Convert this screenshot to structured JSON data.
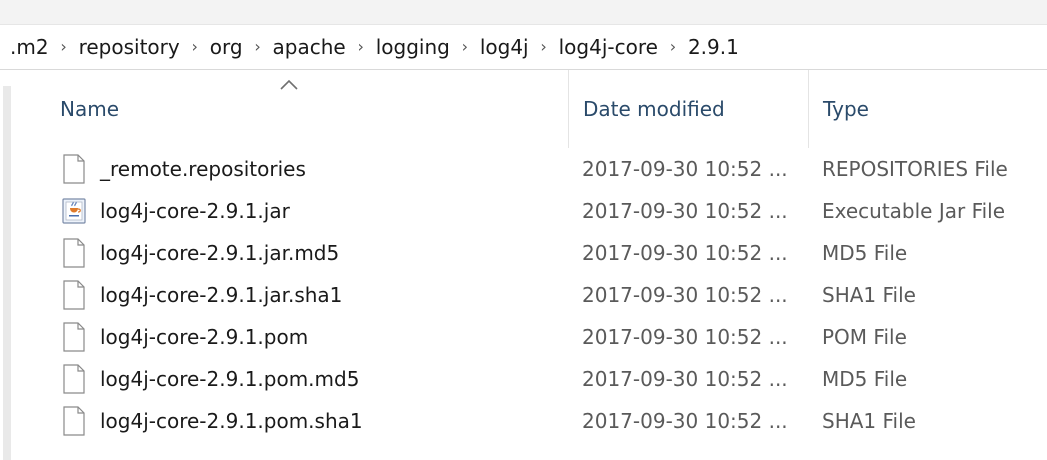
{
  "breadcrumb": {
    "items": [
      ".m2",
      "repository",
      "org",
      "apache",
      "logging",
      "log4j",
      "log4j-core",
      "2.9.1"
    ],
    "separator": "›"
  },
  "columns": {
    "name": "Name",
    "date_modified": "Date modified",
    "type": "Type",
    "sort_indicator": "^"
  },
  "files": [
    {
      "name": "_remote.repositories",
      "date": "2017-09-30 10:52 ...",
      "type": "REPOSITORIES File",
      "icon": "generic-file-icon"
    },
    {
      "name": "log4j-core-2.9.1.jar",
      "date": "2017-09-30 10:52 ...",
      "type": "Executable Jar File",
      "icon": "java-jar-icon"
    },
    {
      "name": "log4j-core-2.9.1.jar.md5",
      "date": "2017-09-30 10:52 ...",
      "type": "MD5 File",
      "icon": "generic-file-icon"
    },
    {
      "name": "log4j-core-2.9.1.jar.sha1",
      "date": "2017-09-30 10:52 ...",
      "type": "SHA1 File",
      "icon": "generic-file-icon"
    },
    {
      "name": "log4j-core-2.9.1.pom",
      "date": "2017-09-30 10:52 ...",
      "type": "POM File",
      "icon": "generic-file-icon"
    },
    {
      "name": "log4j-core-2.9.1.pom.md5",
      "date": "2017-09-30 10:52 ...",
      "type": "MD5 File",
      "icon": "generic-file-icon"
    },
    {
      "name": "log4j-core-2.9.1.pom.sha1",
      "date": "2017-09-30 10:52 ...",
      "type": "SHA1 File",
      "icon": "generic-file-icon"
    }
  ]
}
